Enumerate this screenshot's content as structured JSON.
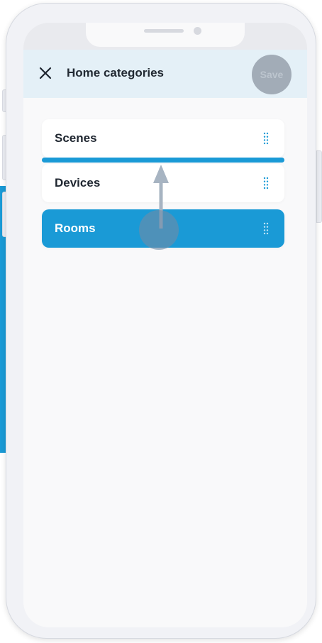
{
  "header": {
    "title": "Home categories",
    "close_icon": "close-icon",
    "save_label": "Save"
  },
  "categories": [
    {
      "label": "Scenes",
      "handle_icon": "drag-handle-icon",
      "state": "normal"
    },
    {
      "label": "Devices",
      "handle_icon": "drag-handle-icon",
      "state": "normal"
    },
    {
      "label": "Rooms",
      "handle_icon": "drag-handle-icon",
      "state": "dragging"
    }
  ],
  "colors": {
    "accent": "#1a9ad6",
    "header_bg": "#e4f0f7",
    "save_disabled_bg": "#a2acb7",
    "text_dark": "#1f2630"
  }
}
